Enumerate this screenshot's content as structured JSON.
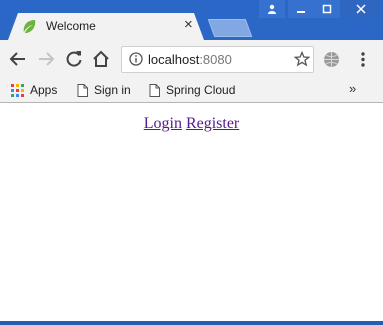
{
  "tab": {
    "title": "Welcome",
    "close": "×",
    "icon": "spring-leaf-icon"
  },
  "window_controls": [
    "user-icon",
    "minimize-icon",
    "maximize-icon",
    "close-icon"
  ],
  "address_bar": {
    "host": "localhost",
    "port": ":8080"
  },
  "bookmarks": {
    "apps": "Apps",
    "items": [
      {
        "label": "Sign in"
      },
      {
        "label": "Spring Cloud"
      }
    ],
    "overflow": "»"
  },
  "page": {
    "links": [
      {
        "label": "Login"
      },
      {
        "label": "Register"
      }
    ]
  },
  "colors": {
    "titlebar": "#2b67c6",
    "visited_link": "#551a8b",
    "spring_green": "#6db33f"
  }
}
